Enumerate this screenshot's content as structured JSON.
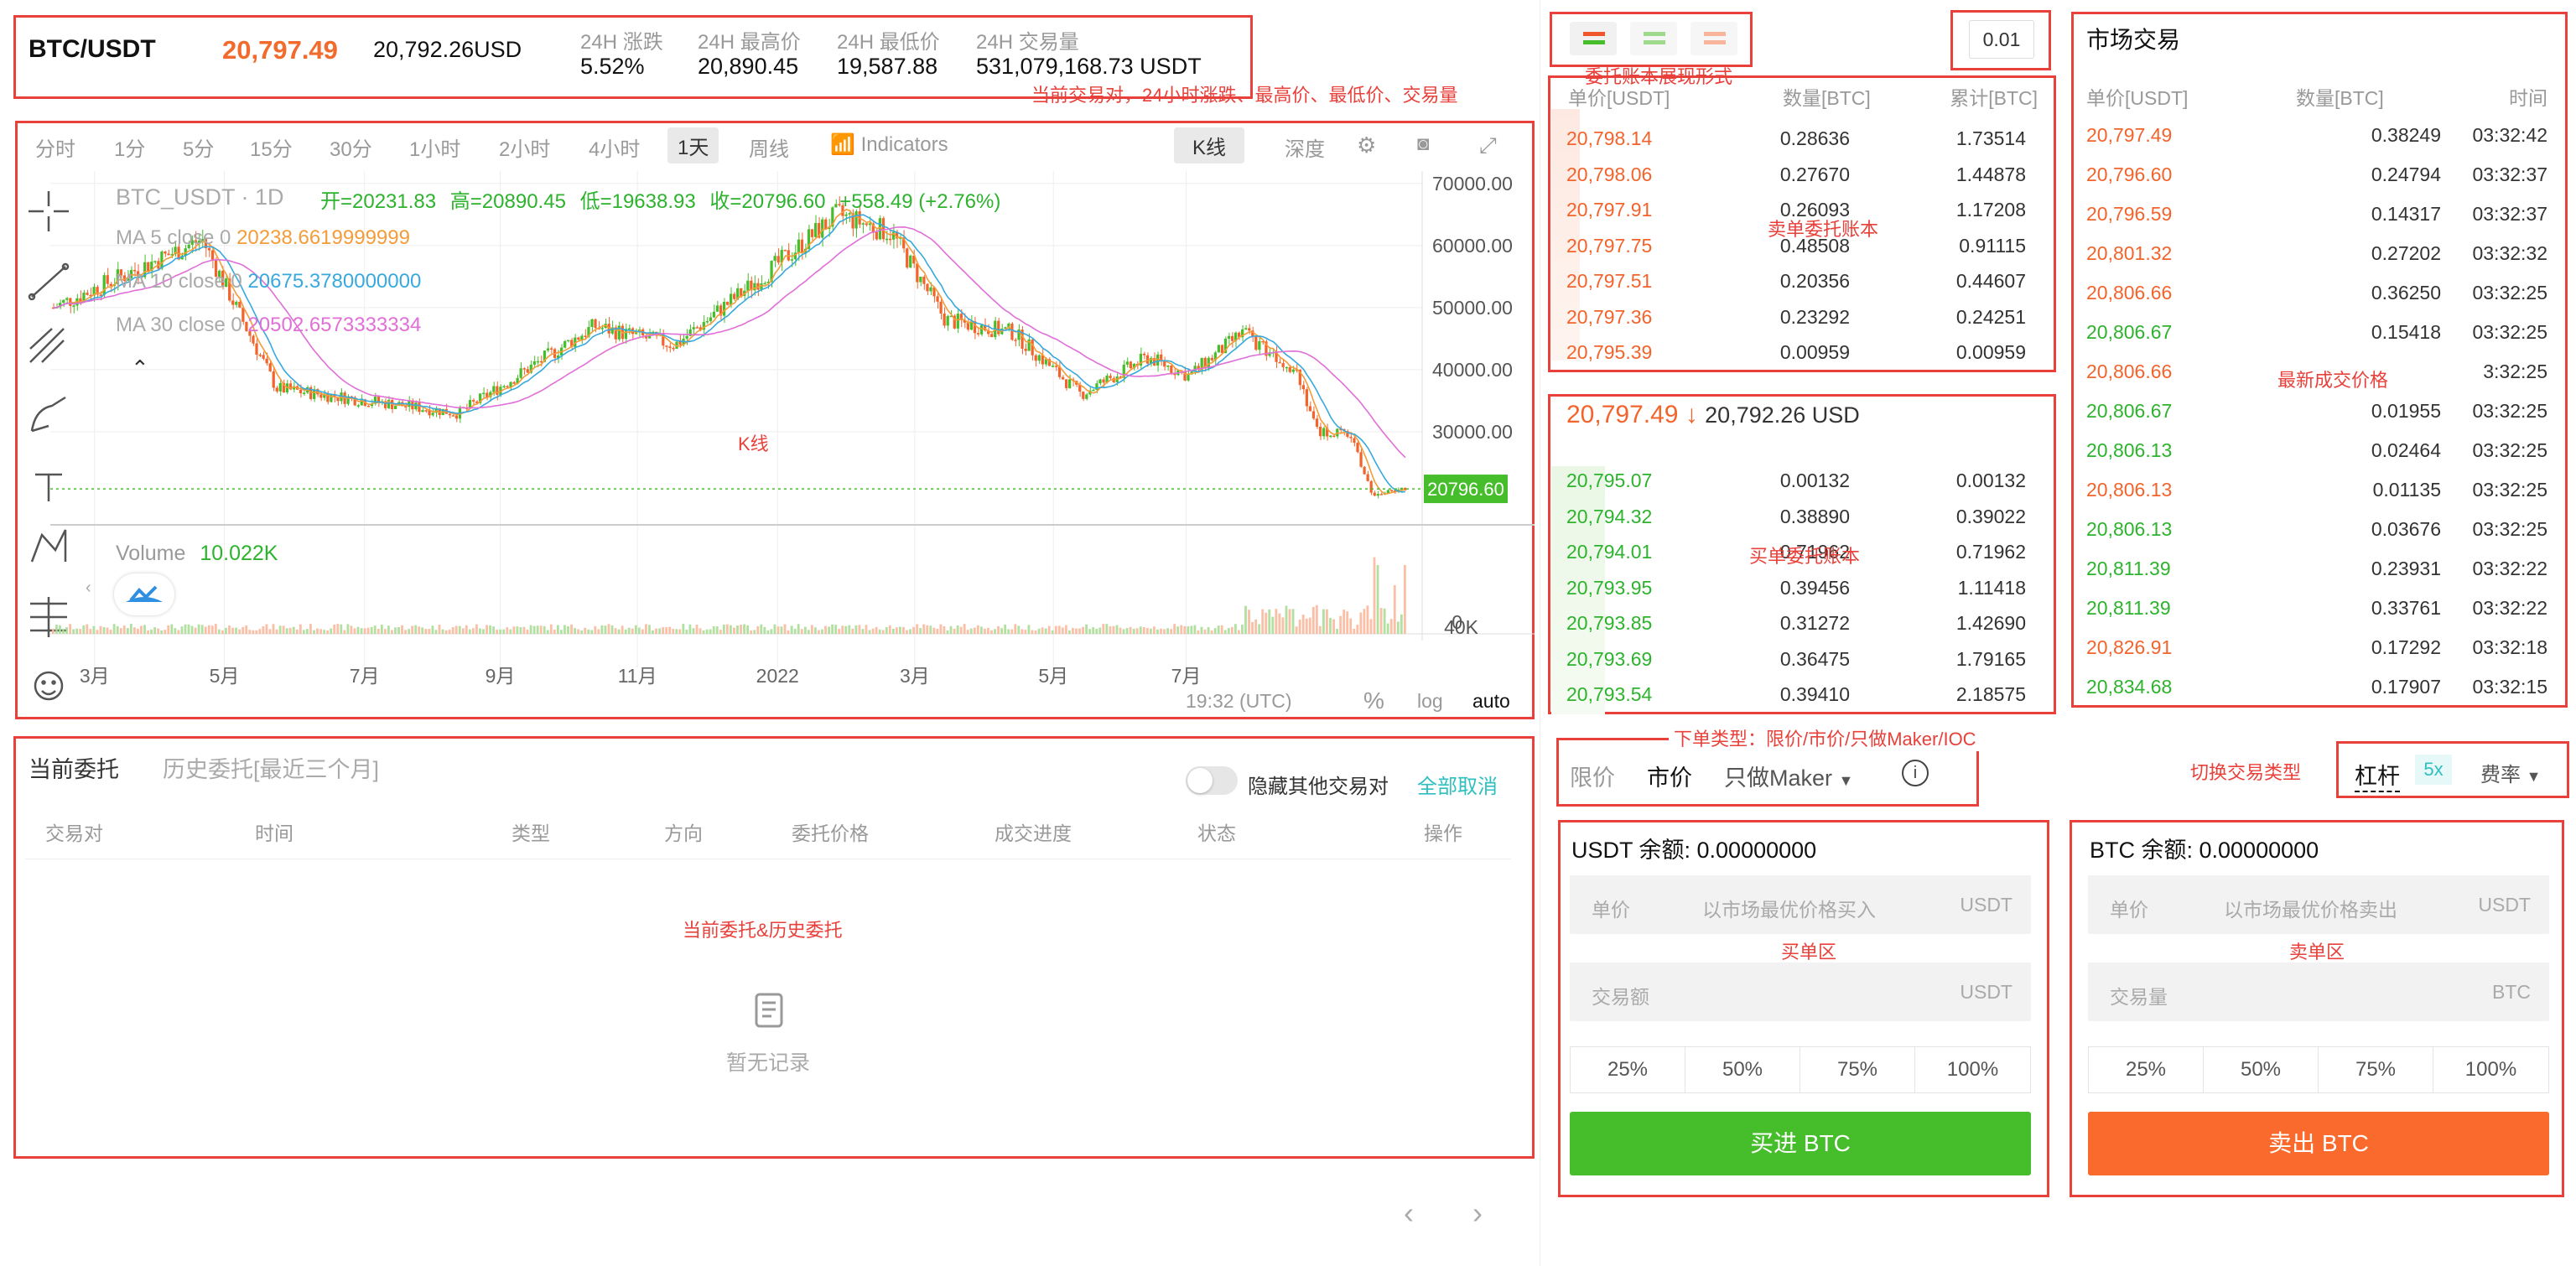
{
  "header": {
    "pair": "BTC/USDT",
    "last_price": "20,797.49",
    "last_price_usd": "20,792.26USD",
    "stats": [
      {
        "label": "24H 涨跌",
        "value": "5.52%"
      },
      {
        "label": "24H 最高价",
        "value": "20,890.45"
      },
      {
        "label": "24H 最低价",
        "value": "19,587.88"
      },
      {
        "label": "24H 交易量",
        "value": "531,079,168.73 USDT"
      }
    ]
  },
  "annotations": {
    "header": "当前交易对，24小时涨跌、最高价、最低价、交易量",
    "book_mode": "委托账本展现形式",
    "asks": "卖单委托账本",
    "bids": "买单委托账本",
    "kline": "K线",
    "latest_trade": "最新成交价格",
    "order_type": "下单类型：限价/市价/只做Maker/IOC",
    "switch_type": "切换交易类型",
    "orders": "当前委托&历史委托",
    "buy_area": "买单区",
    "sell_area": "卖单区"
  },
  "chart_toolbar": {
    "intervals": [
      "分时",
      "1分",
      "5分",
      "15分",
      "30分",
      "1小时",
      "2小时",
      "4小时",
      "1天",
      "周线"
    ],
    "active_interval": "1天",
    "indicators": "Indicators",
    "kline_tab": "K线",
    "depth_tab": "深度"
  },
  "chart_data": {
    "type": "candlestick",
    "title": "BTC_USDT · 1D",
    "ohlc_line": {
      "open": "开=20231.83",
      "high": "高=20890.45",
      "low": "低=19638.93",
      "close": "收=20796.60",
      "change": "+558.49 (+2.76%)"
    },
    "ma": [
      {
        "name": "MA 5 close 0",
        "value": "20238.6619999999",
        "color": "#f39c3a"
      },
      {
        "name": "MA 10 close 0",
        "value": "20675.3780000000",
        "color": "#39a9dd"
      },
      {
        "name": "MA 30 close 0",
        "value": "20502.6573333334",
        "color": "#e06fd8"
      }
    ],
    "y_ticks": [
      "70000.00",
      "60000.00",
      "50000.00",
      "40000.00",
      "30000.00"
    ],
    "ylim": [
      15000,
      72000
    ],
    "last_label": "20796.60",
    "last_value": 20796.6,
    "x_ticks": [
      "3月",
      "5月",
      "7月",
      "9月",
      "11月",
      "2022",
      "3月",
      "5月",
      "7月"
    ],
    "trend": [
      {
        "x": 0,
        "y": 50000
      },
      {
        "x": 0.07,
        "y": 57000
      },
      {
        "x": 0.11,
        "y": 61000
      },
      {
        "x": 0.165,
        "y": 37000
      },
      {
        "x": 0.3,
        "y": 33000
      },
      {
        "x": 0.4,
        "y": 47000
      },
      {
        "x": 0.46,
        "y": 44000
      },
      {
        "x": 0.53,
        "y": 56000
      },
      {
        "x": 0.58,
        "y": 65000
      },
      {
        "x": 0.62,
        "y": 62000
      },
      {
        "x": 0.66,
        "y": 48000
      },
      {
        "x": 0.71,
        "y": 46000
      },
      {
        "x": 0.76,
        "y": 36000
      },
      {
        "x": 0.81,
        "y": 42000
      },
      {
        "x": 0.84,
        "y": 39000
      },
      {
        "x": 0.88,
        "y": 46000
      },
      {
        "x": 0.92,
        "y": 40000
      },
      {
        "x": 0.935,
        "y": 30000
      },
      {
        "x": 0.96,
        "y": 29500
      },
      {
        "x": 0.975,
        "y": 20000
      },
      {
        "x": 1,
        "y": 20800
      }
    ],
    "volume_label": "Volume",
    "volume_value": "10.022K",
    "volume_ticks": [
      "40K",
      "0"
    ],
    "footer_time": "19:32 (UTC)",
    "footer_pct": "%",
    "footer_log": "log",
    "footer_auto": "auto"
  },
  "orderbook": {
    "tick": "0.01",
    "headers": [
      "单价[USDT]",
      "数量[BTC]",
      "累计[BTC]"
    ],
    "asks": [
      [
        "20,798.14",
        "0.28636",
        "1.73514"
      ],
      [
        "20,798.06",
        "0.27670",
        "1.44878"
      ],
      [
        "20,797.91",
        "0.26093",
        "1.17208"
      ],
      [
        "20,797.75",
        "0.48508",
        "0.91115"
      ],
      [
        "20,797.51",
        "0.20356",
        "0.44607"
      ],
      [
        "20,797.36",
        "0.23292",
        "0.24251"
      ],
      [
        "20,795.39",
        "0.00959",
        "0.00959"
      ]
    ],
    "mid_price": "20,797.49",
    "mid_arrow": "↓",
    "mid_usd": "20,792.26 USD",
    "bids": [
      [
        "20,795.07",
        "0.00132",
        "0.00132"
      ],
      [
        "20,794.32",
        "0.38890",
        "0.39022"
      ],
      [
        "20,794.01",
        "0.71962",
        "0.71962"
      ],
      [
        "20,793.95",
        "0.39456",
        "1.11418"
      ],
      [
        "20,793.85",
        "0.31272",
        "1.42690"
      ],
      [
        "20,793.69",
        "0.36475",
        "1.79165"
      ],
      [
        "20,793.54",
        "0.39410",
        "2.18575"
      ]
    ]
  },
  "trades": {
    "title": "市场交易",
    "headers": [
      "单价[USDT]",
      "数量[BTC]",
      "时间"
    ],
    "rows": [
      [
        "20,797.49",
        "0.38249",
        "03:32:42",
        "red"
      ],
      [
        "20,796.60",
        "0.24794",
        "03:32:37",
        "red"
      ],
      [
        "20,796.59",
        "0.14317",
        "03:32:37",
        "red"
      ],
      [
        "20,801.32",
        "0.27202",
        "03:32:32",
        "red"
      ],
      [
        "20,806.66",
        "0.36250",
        "03:32:25",
        "red"
      ],
      [
        "20,806.67",
        "0.15418",
        "03:32:25",
        "green"
      ],
      [
        "20,806.66",
        "",
        "3:32:25",
        "red"
      ],
      [
        "20,806.67",
        "0.01955",
        "03:32:25",
        "green"
      ],
      [
        "20,806.13",
        "0.02464",
        "03:32:25",
        "green"
      ],
      [
        "20,806.13",
        "0.01135",
        "03:32:25",
        "red"
      ],
      [
        "20,806.13",
        "0.03676",
        "03:32:25",
        "green"
      ],
      [
        "20,811.39",
        "0.23931",
        "03:32:22",
        "green"
      ],
      [
        "20,811.39",
        "0.33761",
        "03:32:22",
        "green"
      ],
      [
        "20,826.91",
        "0.17292",
        "03:32:18",
        "red"
      ],
      [
        "20,834.68",
        "0.17907",
        "03:32:15",
        "green"
      ]
    ]
  },
  "orders": {
    "tab_current": "当前委托",
    "tab_history": "历史委托[最近三个月]",
    "hide_others": "隐藏其他交易对",
    "cancel_all": "全部取消",
    "columns": [
      "交易对",
      "时间",
      "类型",
      "方向",
      "委托价格",
      "成交进度",
      "状态",
      "操作"
    ],
    "empty": "暂无记录"
  },
  "trade_form": {
    "order_types": [
      "限价",
      "市价",
      "只做Maker"
    ],
    "active_type": "市价",
    "lever_label": "杠杆",
    "lever_value": "5x",
    "fee_label": "费率",
    "buy": {
      "balance": "USDT 余额: 0.00000000",
      "price_label": "单价",
      "price_placeholder": "以市场最优价格买入",
      "price_unit": "USDT",
      "amount_label": "交易额",
      "amount_unit": "USDT",
      "pcts": [
        "25%",
        "50%",
        "75%",
        "100%"
      ],
      "button": "买进 BTC"
    },
    "sell": {
      "balance": "BTC 余额: 0.00000000",
      "price_label": "单价",
      "price_placeholder": "以市场最优价格卖出",
      "price_unit": "USDT",
      "amount_label": "交易量",
      "amount_unit": "BTC",
      "pcts": [
        "25%",
        "50%",
        "75%",
        "100%"
      ],
      "button": "卖出 BTC"
    }
  },
  "colors": {
    "up": "#2db32d",
    "down": "#f26a2c",
    "buy_btn": "#46bd2a",
    "sell_btn": "#fa6a2d",
    "annot": "#e8403a"
  }
}
